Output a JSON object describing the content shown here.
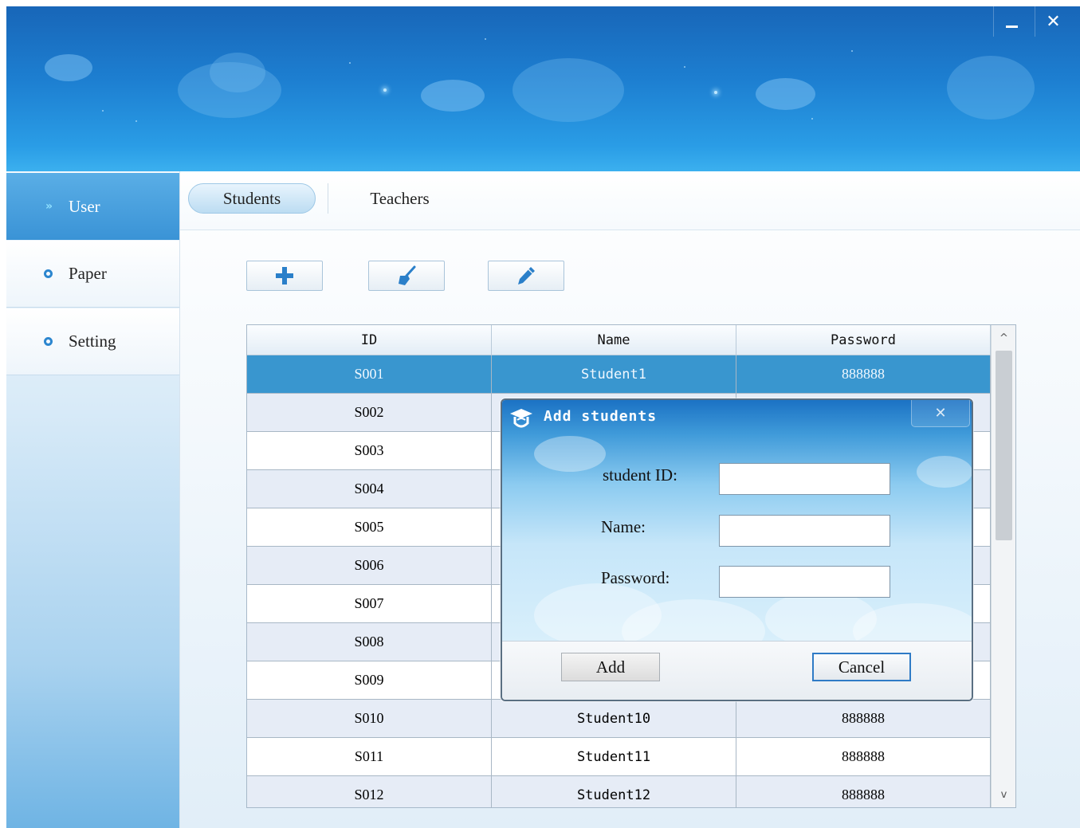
{
  "window": {
    "minimize_glyph": "–",
    "close_glyph": "✕"
  },
  "sidebar": {
    "items": [
      {
        "label": "User",
        "active": true,
        "icon": "double-chevron-right-icon"
      },
      {
        "label": "Paper",
        "active": false,
        "icon": "ring-icon"
      },
      {
        "label": "Setting",
        "active": false,
        "icon": "ring-icon"
      }
    ]
  },
  "tabs": [
    {
      "label": "Students",
      "active": true
    },
    {
      "label": "Teachers",
      "active": false
    }
  ],
  "toolbar": [
    {
      "icon": "plus-icon"
    },
    {
      "icon": "broom-icon"
    },
    {
      "icon": "pencil-icon"
    }
  ],
  "table": {
    "columns": [
      "ID",
      "Name",
      "Password"
    ],
    "rows": [
      {
        "id": "S001",
        "name": "Student1",
        "password": "888888",
        "selected": true
      },
      {
        "id": "S002",
        "name": "",
        "password": ""
      },
      {
        "id": "S003",
        "name": "",
        "password": ""
      },
      {
        "id": "S004",
        "name": "",
        "password": ""
      },
      {
        "id": "S005",
        "name": "",
        "password": ""
      },
      {
        "id": "S006",
        "name": "",
        "password": ""
      },
      {
        "id": "S007",
        "name": "",
        "password": ""
      },
      {
        "id": "S008",
        "name": "",
        "password": ""
      },
      {
        "id": "S009",
        "name": "",
        "password": ""
      },
      {
        "id": "S010",
        "name": "Student10",
        "password": "888888"
      },
      {
        "id": "S011",
        "name": "Student11",
        "password": "888888"
      },
      {
        "id": "S012",
        "name": "Student12",
        "password": "888888"
      }
    ],
    "scroll_up_glyph": "^",
    "scroll_down_glyph": "v"
  },
  "dialog": {
    "title": "Add students",
    "close_glyph": "✕",
    "fields": {
      "student_id_label": "student ID:",
      "student_id_value": "",
      "name_label": "Name:",
      "name_value": "",
      "password_label": "Password:",
      "password_value": ""
    },
    "add_label": "Add",
    "cancel_label": "Cancel"
  },
  "colors": {
    "banner": "#1d7fd1",
    "selected_row": "#3996cf",
    "accent": "#2c86cf"
  }
}
